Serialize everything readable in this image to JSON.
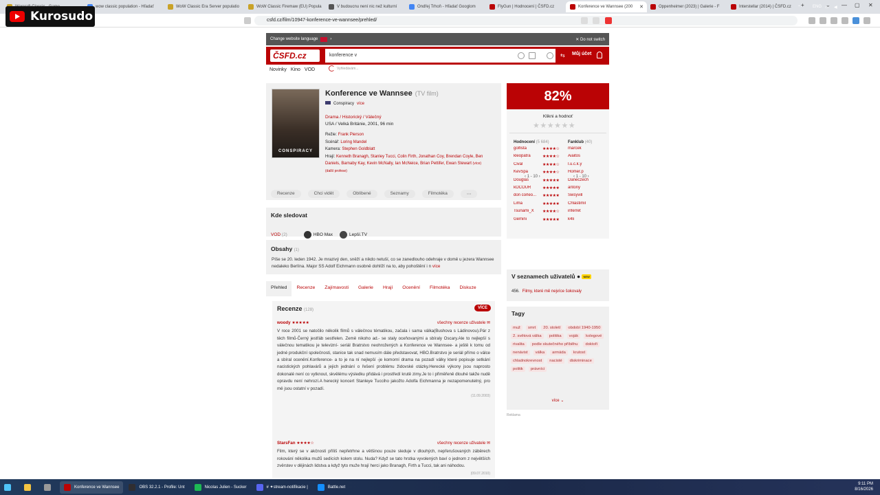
{
  "browser": {
    "tabs": [
      {
        "label": "Warcraft Classic - Game",
        "color": "#c9a227"
      },
      {
        "label": "wow classic population - Hľadať",
        "color": "#4285f4"
      },
      {
        "label": "WoW Classic Era Server populatio",
        "color": "#c9a227"
      },
      {
        "label": "WoW Classic Firemaw (EU) Popula",
        "color": "#c9a227"
      },
      {
        "label": "V budoucnu není nic než kulturní",
        "color": "#555555"
      },
      {
        "label": "Ondřej Trhoň - Hľadať Googlom",
        "color": "#4285f4"
      },
      {
        "label": "FlyGun | Hodnocení | ČSFD.cz",
        "color": "#ba0305"
      },
      {
        "label": "Konference ve Wannsee (200",
        "color": "#ba0305"
      },
      {
        "label": "Oppenheimer (2023) | Galerie - F",
        "color": "#ba0305"
      },
      {
        "label": "Interstellar (2014) | ČSFD.cz",
        "color": "#ba0305"
      }
    ],
    "active_tab": 7,
    "url": "csfd.cz/film/10947-konference-ve-wannsee/prehled/"
  },
  "overlay": {
    "channel": "Kurosudo"
  },
  "site": {
    "lang_bar": {
      "label": "Change website language",
      "no_switch": "Do not switch"
    },
    "logo": "ČSFD.cz",
    "search_value": "konference v",
    "account": "Můj účet",
    "subnav": [
      "Novinky",
      "Kino",
      "VOD"
    ],
    "suggest_text": "Vyhledávám..."
  },
  "film": {
    "title": "Konference ve Wannsee",
    "type": "(TV film)",
    "orig_title": "Conspiracy",
    "more": "více",
    "genres": "Drama / Historický / Válečný",
    "origin": "USA / Velká Británie, 2001, 96 min",
    "director_label": "Režie:",
    "director": "Frank Pierson",
    "writer_label": "Scénář:",
    "writer": "Loring Mandel",
    "camera_label": "Kamera:",
    "camera": "Stephen Goldblatt",
    "actors_label": "Hrají:",
    "actors": "Kenneth Branagh, Stanley Tucci, Colin Firth, Jonathan Coy, Brendan Coyle, Ben Daniels, Barnaby Kay, Kevin McNally, Ian McNeice, Brian Pettifer, Ewan Stewart",
    "actors_more": "(více)",
    "more_profiles": "(další profese)",
    "poster_text": "CONSPIRACY",
    "actions": [
      "Recenze",
      "Chci vidět",
      "Oblíbené",
      "Seznamy",
      "Filmotéka",
      "⋯"
    ]
  },
  "where": {
    "title": "Kde sledovat",
    "vod_label": "VOD",
    "vod_count": "(2)",
    "services": [
      "HBO Max",
      "Lepší.TV"
    ]
  },
  "plot": {
    "title": "Obsahy",
    "count": "(1)",
    "text": "Píše se 20. leden 1942. Je mrazivý den, sněží a nikdo netuší, co se zanedlouho odehraje v domě u jezera Wannsee nedaleko Berlína. Major SS Adolf Eichmann osobně dohlíží na to, aby pohoštění i n",
    "more": "více"
  },
  "tabs": [
    "Přehled",
    "Recenze",
    "Zajímavosti",
    "Galerie",
    "Hrají",
    "Ocenění",
    "Filmotéka",
    "Diskuze"
  ],
  "reviews": {
    "title": "Recenze",
    "count": "(128)",
    "more_button": "VÍCE",
    "items": [
      {
        "author": "woody",
        "stars": "★★★★★",
        "all": "všechny recenze uživatele",
        "text": "V roce 2001 se natočilo několik filmů s válečnou tématikou, začala i sama válka(Bushova s Ládinovou).Pár z těch filmů-Černý jestřáb sestřelen. Země nikoho ad.- se staly oceňovanými a sbíraly Oscary.Ale to nejlepší s válečnou tematikou je televizní- seriál Bratrstvo neohrožených a Konference ve Wannsee- a ještě k tomu od jedné produkční společnosti, stanice tak snad nemusím dále představovat, HBO.Bratrstvo je seriál přímo o válce a sbíral ocenění.Konference- a to je na ní nejlepší -je komorní drama na pozadí války které popisuje setkání nacistických pohlavárů a jejich jednání o řešení problému židovské otázky.Herecké výkony jsou naprosto dokonalé není co vytknout, skvělému výsledku přidává i prostředí krutě zimy.Je to i přiměřeně dlouhé takže nudě opravdu není nehrozí.A herecký koncert Stanleye Tucciho jakožto Adolfa Eichmanna je nezapomenutelný, pro mě jsou ostatní v pozadí.",
        "date": "(11.09.2003)"
      },
      {
        "author": "StarsFan",
        "stars": "★★★★☆",
        "all": "všechny recenze uživatele",
        "text": "Film, který se v akčnosti příliš nepřetrhne a většinou pouze sleduje v dlouhých, nepřerušovaných záběrech rokování několika mužů sedících kolem stolu. Nuda? Když se tato hrstka vyvolených baví o jednom z největších zvěrstev v dějinách lidstva a když tyto muže hrají herci jako Branagh, Firth a Tucci, tak ani náhodou.",
        "date": "(09.07.2010)"
      }
    ]
  },
  "rating": {
    "percent": "82%",
    "click_label": "Klikni a hodnoť",
    "ratings_label": "Hodnocení",
    "ratings_count": "(5 684)",
    "fanclub_label": "Fanklub",
    "fanclub_count": "(40)",
    "ratings": [
      {
        "name": "golfista",
        "stars": "★★★★☆"
      },
      {
        "name": "kleopatra",
        "stars": "★★★★☆"
      },
      {
        "name": "Cival",
        "stars": "★★★★☆"
      },
      {
        "name": "KevSpa",
        "stars": "★★★★☆"
      },
      {
        "name": "Douglas",
        "stars": "★★★★★"
      },
      {
        "name": "kOCOUR",
        "stars": "★★★★★"
      },
      {
        "name": "don corleo...",
        "stars": "★★★★★"
      },
      {
        "name": "Lima",
        "stars": "★★★★★"
      },
      {
        "name": "Tsunami_X",
        "stars": "★★★★☆"
      },
      {
        "name": "Gemini",
        "stars": "★★★★★"
      }
    ],
    "fanclub": [
      "marcek",
      "Aiaitos",
      "l.u.c.k.y",
      "Homer.p",
      "Daneczech",
      "antony",
      "Swsyvill",
      "Chlastimil",
      "inferret",
      "k4li"
    ],
    "pager_left": "1 - 10",
    "pager_right": "1 - 10"
  },
  "lists": {
    "title": "V seznamech uživatelů",
    "new_badge": "NEW",
    "rank": "456.",
    "item": "Filmy, které mě nejvíce šokovaly"
  },
  "tags": {
    "title": "Tagy",
    "items": [
      "muž",
      "smrt",
      "20. století",
      "období 1940-1950",
      "2. světová válka",
      "politika",
      "voják",
      "kolegové",
      "rivalita",
      "podle skutečného příběhu",
      "doktoři",
      "nenávist",
      "válka",
      "armáda",
      "krutost",
      "chladnokrevnost",
      "nacisté",
      "diskriminace",
      "politik",
      "právníci"
    ],
    "more": "více"
  },
  "reklama": "Reklama",
  "taskbar": {
    "apps": [
      {
        "label": "Konference ve Wannsee",
        "color": "#ba0305"
      },
      {
        "label": "OBS 32.2.1 - Profile: Unt",
        "color": "#302e31"
      },
      {
        "label": "Nicolas Julien - Sucker",
        "color": "#1db954"
      },
      {
        "label": "# ✦stream-notifikacie |",
        "color": "#5865f2"
      },
      {
        "label": "Battle.net",
        "color": "#148eff"
      }
    ],
    "lang": "ENG",
    "time": "9:11 PM",
    "date": "8/16/2026"
  }
}
